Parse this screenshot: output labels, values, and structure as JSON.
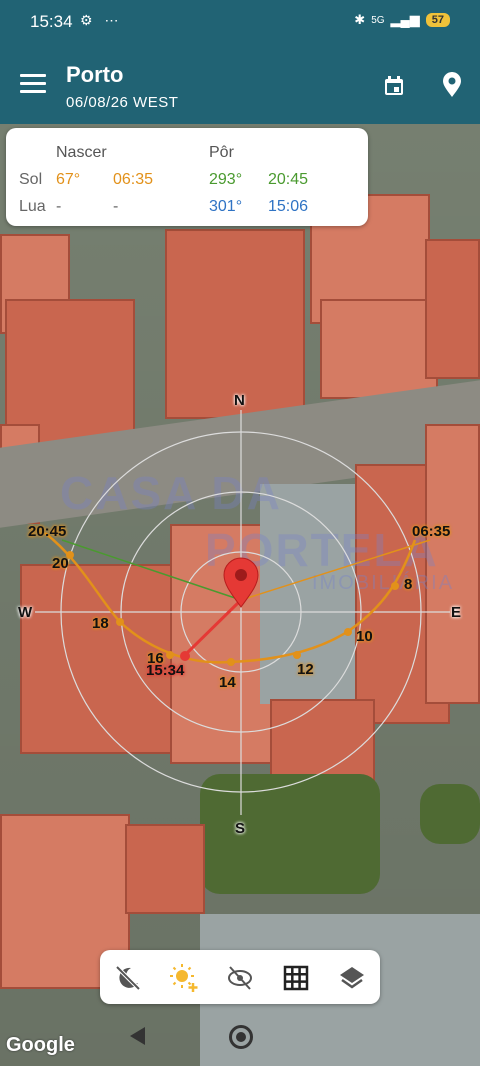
{
  "status": {
    "time": "15:34",
    "icons": "⚙ ⋯",
    "net": "5G",
    "battery": "57"
  },
  "appbar": {
    "title": "Porto",
    "subtitle": "06/08/26  WEST"
  },
  "card": {
    "rise_header": "Nascer",
    "set_header": "Pôr",
    "sun_label": "Sol",
    "moon_label": "Lua",
    "sun_rise_az": "67°",
    "sun_rise_time": "06:35",
    "sun_set_az": "293°",
    "sun_set_time": "20:45",
    "moon_rise_az": "-",
    "moon_rise_time": "-",
    "moon_set_az": "301°",
    "moon_set_time": "15:06"
  },
  "compass": {
    "n": "N",
    "s": "S",
    "e": "E",
    "w": "W"
  },
  "sun_path_labels": {
    "sunset": "20:45",
    "h20": "20",
    "h18": "18",
    "h16": "16",
    "now": "15:34",
    "h14": "14",
    "h12": "12",
    "h10": "10",
    "h8": "8",
    "sunrise": "06:35"
  },
  "watermark": {
    "line1": "CASA DA",
    "line2": "PORTELA",
    "line3": "IMOBILIÁRIA"
  },
  "google": "Google",
  "colors": {
    "appbar": "#216374",
    "sun": "#e2911a",
    "sunset": "#4a9a2f",
    "moon": "#2f73c4",
    "marker": "#e53935"
  }
}
